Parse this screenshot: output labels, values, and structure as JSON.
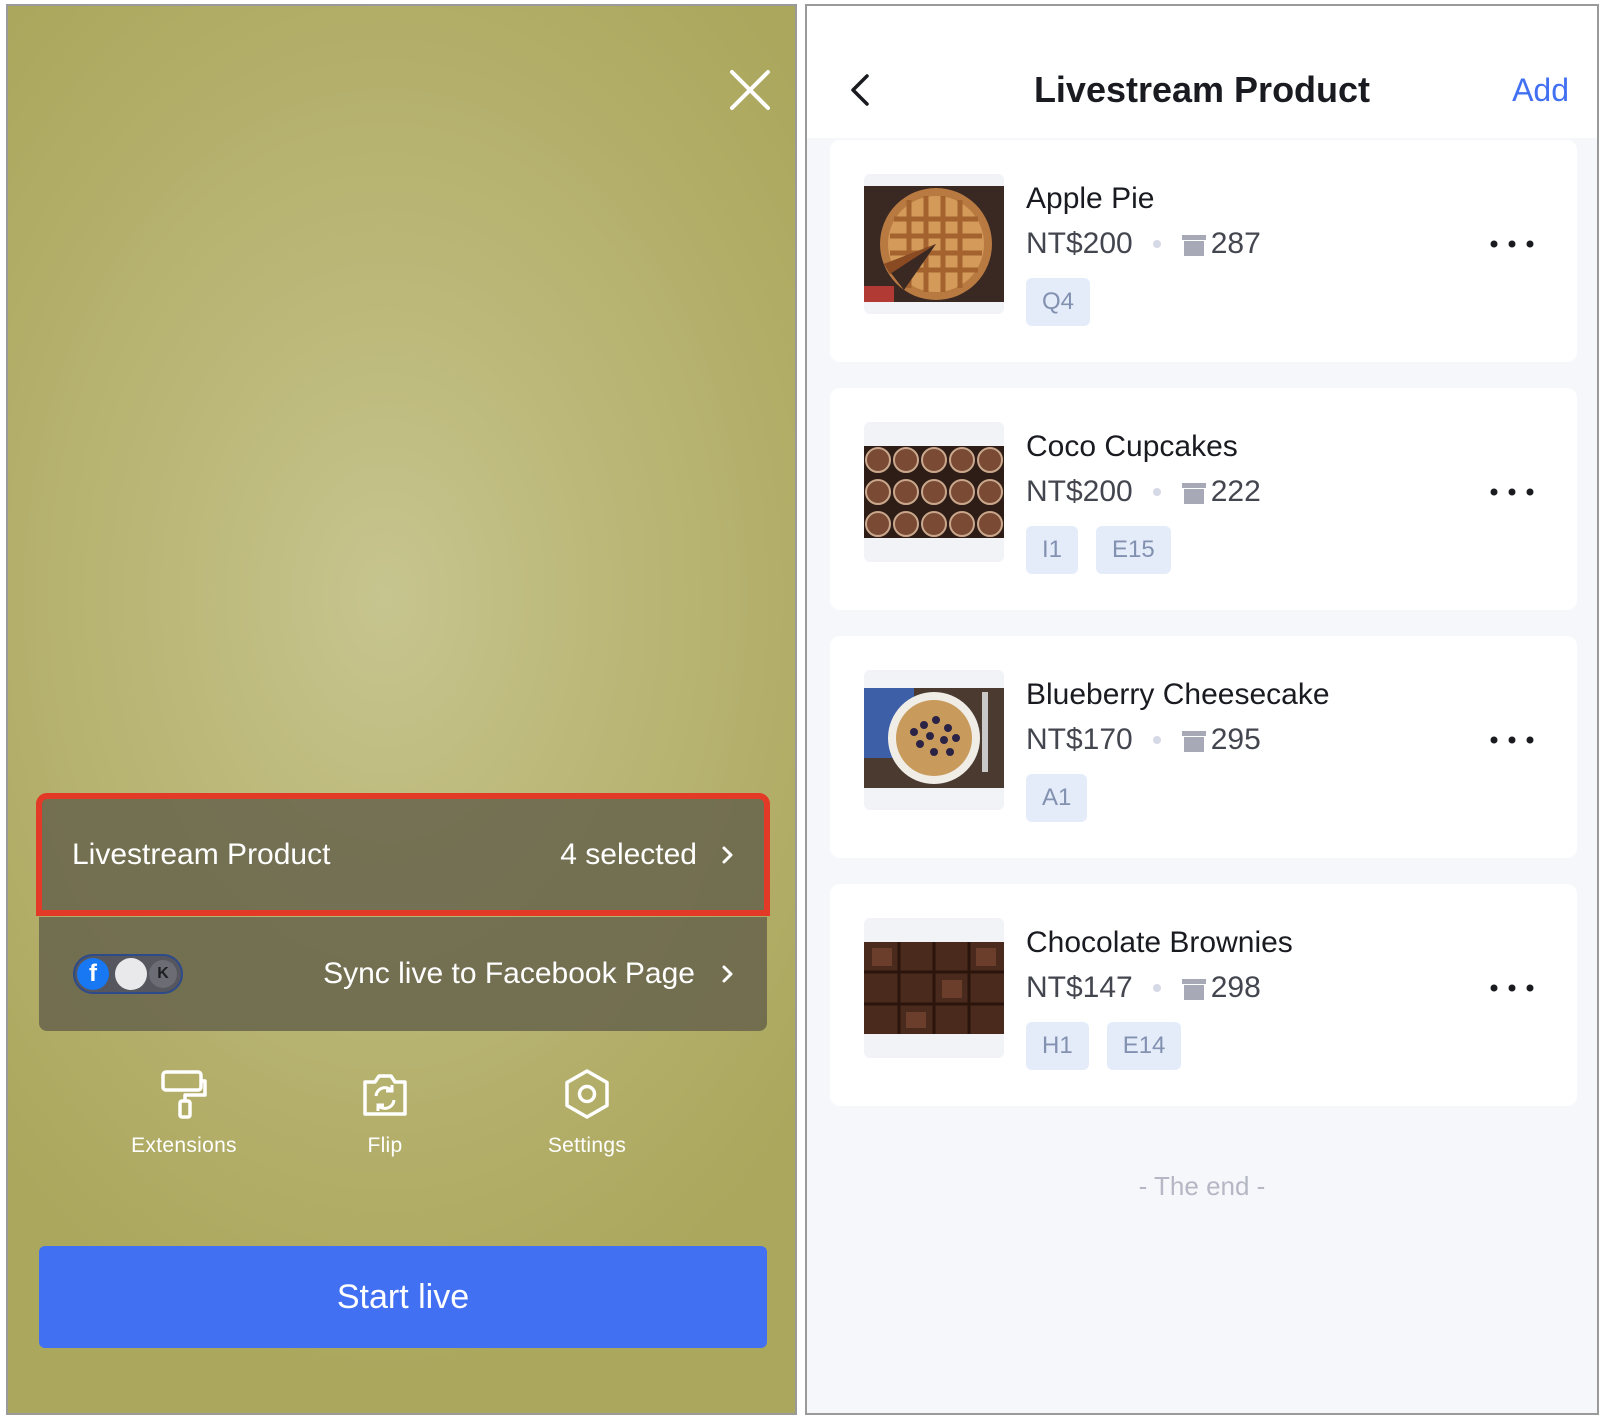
{
  "left": {
    "product_row": {
      "label": "Livestream Product",
      "value": "4 selected"
    },
    "sync_row": {
      "label": "Sync live to Facebook Page",
      "toggle_letter": "K",
      "fb_letter": "f"
    },
    "tools": [
      {
        "label": "Extensions",
        "icon": "paint-roller-icon"
      },
      {
        "label": "Flip",
        "icon": "camera-flip-icon"
      },
      {
        "label": "Settings",
        "icon": "hexagon-settings-icon"
      }
    ],
    "start_button": "Start live",
    "colors": {
      "accent": "#4270f3",
      "highlight": "#e23a26"
    }
  },
  "right": {
    "header": {
      "title": "Livestream Product",
      "add_label": "Add"
    },
    "products": [
      {
        "name": "Apple Pie",
        "price": "NT$200",
        "stock": "287",
        "tags": [
          "Q4"
        ]
      },
      {
        "name": "Coco Cupcakes",
        "price": "NT$200",
        "stock": "222",
        "tags": [
          "I1",
          "E15"
        ]
      },
      {
        "name": "Blueberry Cheesecake",
        "price": "NT$170",
        "stock": "295",
        "tags": [
          "A1"
        ]
      },
      {
        "name": "Chocolate Brownies",
        "price": "NT$147",
        "stock": "298",
        "tags": [
          "H1",
          "E14"
        ]
      }
    ],
    "end_text": "- The end -"
  }
}
